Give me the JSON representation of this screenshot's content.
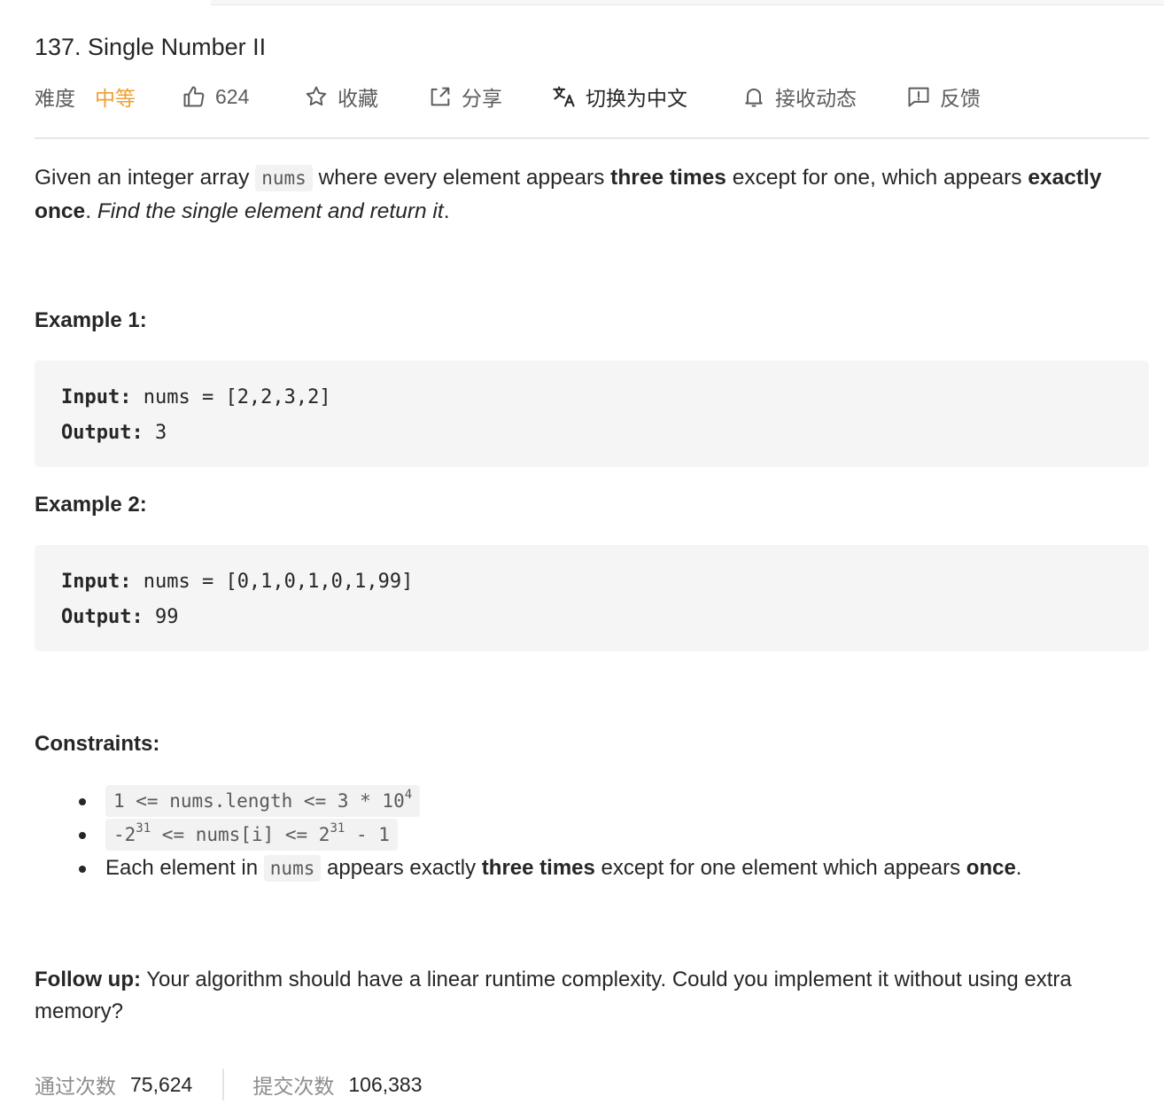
{
  "problem": {
    "title": "137. Single Number II",
    "difficulty_label": "难度",
    "difficulty_value": "中等",
    "likes": "624",
    "favorite_label": "收藏",
    "share_label": "分享",
    "translate_label": "切换为中文",
    "subscribe_label": "接收动态",
    "feedback_label": "反馈"
  },
  "description": {
    "part1": "Given an integer array ",
    "code1": "nums",
    "part2": " where every element appears ",
    "bold1": "three times",
    "part3": " except for one, which appears ",
    "bold2": "exactly once",
    "part4": ". ",
    "italic1": "Find the single element and return it",
    "part5": "."
  },
  "examples": [
    {
      "heading": "Example 1:",
      "input_label": "Input:",
      "input_value": " nums = [2,2,3,2]",
      "output_label": "Output:",
      "output_value": " 3"
    },
    {
      "heading": "Example 2:",
      "input_label": "Input:",
      "input_value": " nums = [0,1,0,1,0,1,99]",
      "output_label": "Output:",
      "output_value": " 99"
    }
  ],
  "constraints": {
    "heading": "Constraints:",
    "c1_base": "1 <= nums.length <= 3 * 10",
    "c1_exp": "4",
    "c2_pre": "-2",
    "c2_exp1": "31",
    "c2_mid": " <= nums[i] <= 2",
    "c2_exp2": "31",
    "c2_post": " - 1",
    "c3_part1": "Each element in ",
    "c3_code": "nums",
    "c3_part2": " appears exactly ",
    "c3_bold1": "three times",
    "c3_part3": " except for one element which appears ",
    "c3_bold2": "once",
    "c3_part4": "."
  },
  "follow_up": {
    "label": "Follow up:",
    "text": " Your algorithm should have a linear runtime complexity. Could you implement it without using extra memory?"
  },
  "stats": {
    "accepted_label": "通过次数",
    "accepted_value": "75,624",
    "submissions_label": "提交次数",
    "submissions_value": "106,383"
  },
  "colors": {
    "difficulty_medium": "#ef9f33",
    "text": "#262626",
    "muted": "#8c8c8c",
    "code_bg": "#f2f2f2",
    "example_bg": "#f5f5f5"
  }
}
